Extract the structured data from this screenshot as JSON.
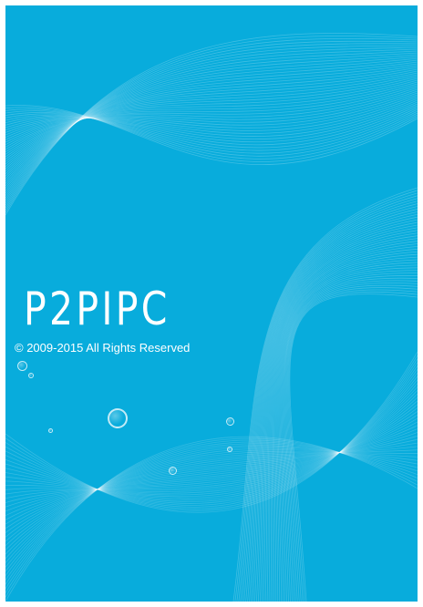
{
  "splash": {
    "app_name": "P2PIPC",
    "copyright": "© 2009-2015 All Rights Reserved",
    "background_color": "#08acdc",
    "text_color": "#ffffff"
  }
}
